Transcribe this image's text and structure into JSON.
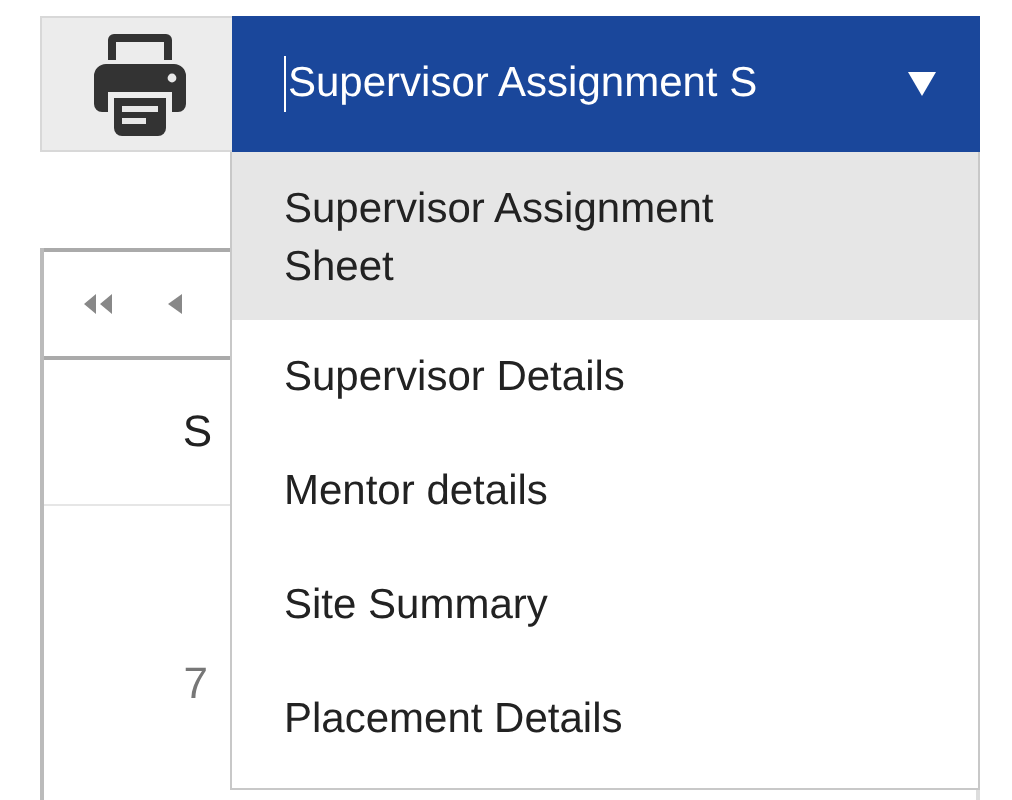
{
  "toolbar": {
    "report_select": {
      "value": "Supervisor Assignment S",
      "expanded": true
    }
  },
  "dropdown": {
    "options": [
      {
        "label": "Supervisor Assignment Sheet",
        "selected": true
      },
      {
        "label": "Supervisor Details",
        "selected": false
      },
      {
        "label": "Mentor details",
        "selected": false
      },
      {
        "label": "Site Summary",
        "selected": false
      },
      {
        "label": "Placement Details",
        "selected": false
      }
    ]
  },
  "calendar": {
    "day_headers": [
      "S"
    ],
    "dates": [
      "7"
    ]
  }
}
